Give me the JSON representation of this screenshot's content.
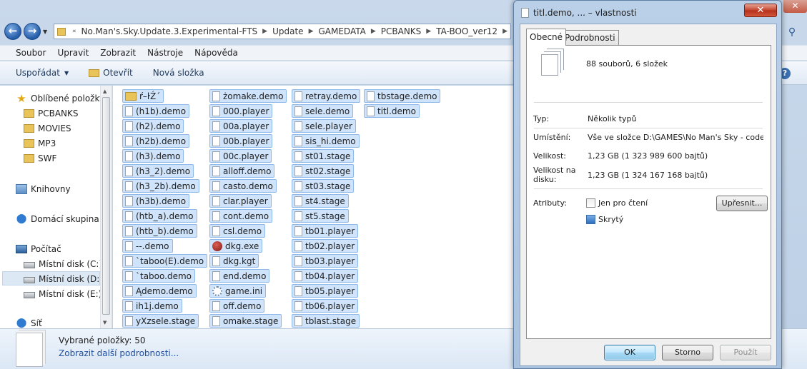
{
  "explorer": {
    "address": [
      "No.Man's.Sky.Update.3.Experimental-FTS",
      "Update",
      "GAMEDATA",
      "PCBANKS",
      "TA-BOO_ver12"
    ],
    "menu": [
      "Soubor",
      "Upravit",
      "Zobrazit",
      "Nástroje",
      "Nápověda"
    ],
    "toolbar": {
      "organize": "Uspořádat",
      "open": "Otevřít",
      "new_folder": "Nová složka"
    },
    "nav": {
      "favorites": "Oblíbené položky",
      "fav_items": [
        "PCBANKS",
        "MOVIES",
        "MP3",
        "SWF"
      ],
      "libraries": "Knihovny",
      "homegroup": "Domácí skupina",
      "computer": "Počítač",
      "disks": [
        "Místní disk (C:)",
        "Místní disk (D:)",
        "Místní disk (E:)"
      ],
      "network": "Síť"
    },
    "columns": [
      [
        "ŕ–ŀŹ´",
        "(h1b).demo",
        "(h2).demo",
        "(h2b).demo",
        "(h3).demo",
        "(h3_2).demo",
        "(h3_2b).demo",
        "(h3b).demo",
        "(htb_a).demo",
        "(htb_b).demo",
        "--.demo",
        "`taboo(E).demo",
        "`taboo.demo",
        "Ądemo.demo",
        "ih1j.demo",
        "yXzsele.stage"
      ],
      [
        "żomake.demo",
        "000.player",
        "00a.player",
        "00b.player",
        "00c.player",
        "alloff.demo",
        "casto.demo",
        "clar.player",
        "cont.demo",
        "csl.demo",
        "dkg.exe",
        "dkg.kgt",
        "end.demo",
        "game.ini",
        "off.demo",
        "omake.stage"
      ],
      [
        "retray.demo",
        "sele.demo",
        "sele.player",
        "sis_hi.demo",
        "st01.stage",
        "st02.stage",
        "st03.stage",
        "st4.stage",
        "st5.stage",
        "tb01.player",
        "tb02.player",
        "tb03.player",
        "tb04.player",
        "tb05.player",
        "tb06.player",
        "tblast.stage"
      ],
      [
        "tbstage.demo",
        "titl.demo"
      ]
    ],
    "details": {
      "selected": "Vybrané položky: 50",
      "more": "Zobrazit další podrobnosti..."
    }
  },
  "dialog": {
    "title": "titl.demo, ... – vlastnosti",
    "close": "✕",
    "tabs": [
      "Obecné",
      "Podrobnosti"
    ],
    "summary": "88 souborů, 6 složek",
    "type_label": "Typ:",
    "type_value": "Několik typů",
    "location_label": "Umístění:",
    "location_value": "Vše ve složce D:\\GAMES\\No Man's Sky - codex\\No.M",
    "size_label": "Velikost:",
    "size_value": "1,23 GB (1 323 989 600 bajtů)",
    "disk_size_label": "Velikost na disku:",
    "disk_size_value": "1,23 GB (1 324 167 168 bajtů)",
    "attributes_label": "Atributy:",
    "readonly_label": "Jen pro čtení",
    "hidden_label": "Skrytý",
    "advanced": "Upřesnit...",
    "ok": "OK",
    "cancel": "Storno",
    "apply": "Použít"
  }
}
